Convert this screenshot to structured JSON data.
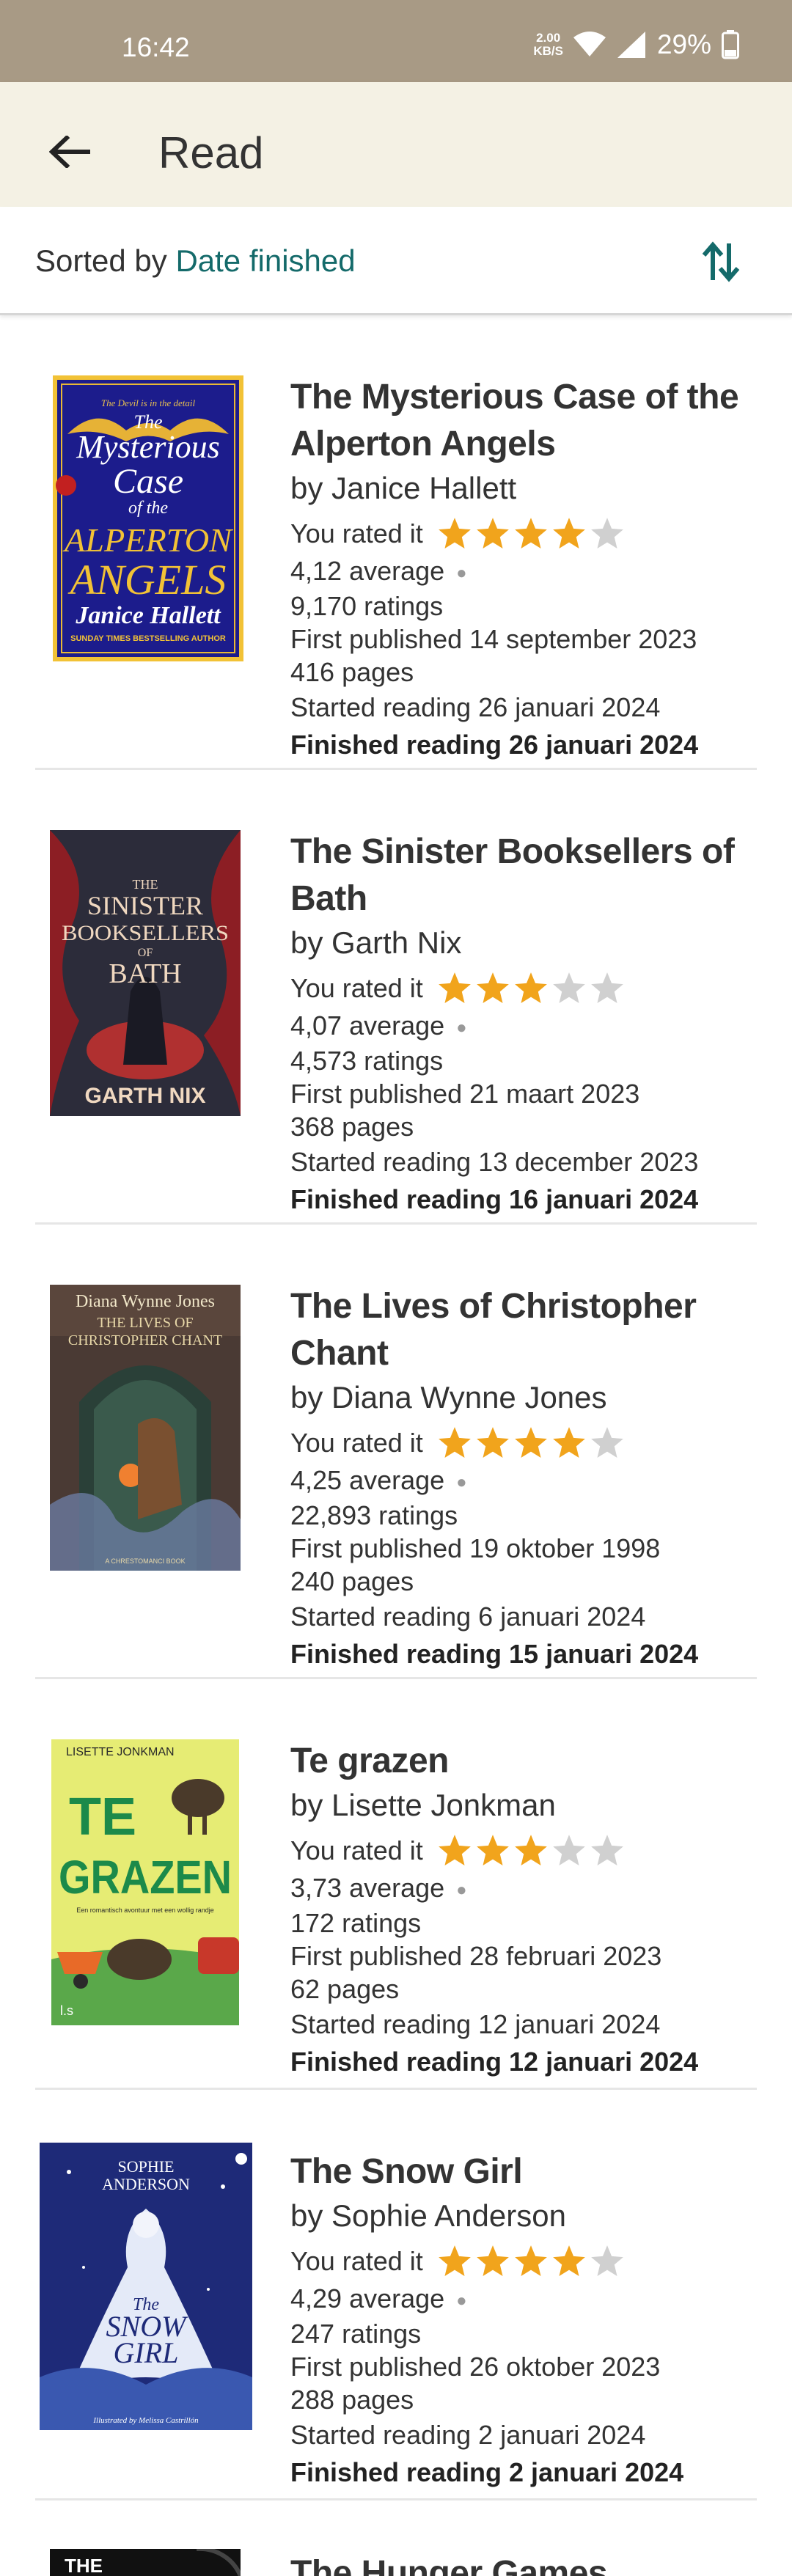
{
  "status": {
    "time": "16:42",
    "net_speed_value": "2.00",
    "net_speed_unit": "KB/S",
    "battery": "29%"
  },
  "appbar": {
    "title": "Read",
    "back_icon": "arrow-left-icon"
  },
  "sort": {
    "prefix": "Sorted by",
    "value": "Date finished",
    "icon": "sort-arrows-icon"
  },
  "colors": {
    "status_bar": "#a89a85",
    "app_bar": "#f4f1e4",
    "accent": "#146a6a",
    "star_filled": "#f1a41c",
    "star_empty": "#d0d0d0"
  },
  "labels": {
    "you_rated": "You rated it"
  },
  "books": [
    {
      "title": "The Mysterious Case of the Alperton Angels",
      "author": "by Janice Hallett",
      "rating": 4,
      "average": "4,12 average",
      "ratings": "9,170 ratings",
      "published": "First published 14 september 2023",
      "pages": "416 pages",
      "started": "Started reading 26 januari 2024",
      "finished": "Finished reading 26 januari 2024",
      "cover": {
        "top_line": "The Devil is in the detail",
        "line1": "The",
        "line2": "Mysterious",
        "line3": "Case",
        "line4": "of the",
        "line5": "ALPERTON",
        "line6": "ANGELS",
        "author": "Janice Hallett",
        "tagline": "SUNDAY TIMES BESTSELLING AUTHOR"
      }
    },
    {
      "title": "The Sinister Booksellers of Bath",
      "author": "by Garth Nix",
      "rating": 3,
      "average": "4,07 average",
      "ratings": "4,573 ratings",
      "published": "First published 21 maart 2023",
      "pages": "368 pages",
      "started": "Started reading 13 december 2023",
      "finished": "Finished reading 16 januari 2024",
      "cover": {
        "line1": "THE",
        "line2": "SINISTER",
        "line3": "BOOKSELLERS",
        "line4": "OF",
        "line5": "BATH",
        "author": "GARTH NIX"
      }
    },
    {
      "title": "The Lives of Christopher Chant",
      "author": "by Diana Wynne Jones",
      "rating": 4,
      "average": "4,25 average",
      "ratings": "22,893 ratings",
      "published": "First published 19 oktober 1998",
      "pages": "240 pages",
      "started": "Started reading 6 januari 2024",
      "finished": "Finished reading 15 januari 2024",
      "cover": {
        "author": "Diana Wynne Jones",
        "line1": "THE LIVES OF",
        "line2": "CHRISTOPHER CHANT",
        "footer": "A CHRESTOMANCI BOOK"
      }
    },
    {
      "title": "Te grazen",
      "author": "by Lisette Jonkman",
      "rating": 3,
      "average": "3,73 average",
      "ratings": "172 ratings",
      "published": "First published 28 februari 2023",
      "pages": "62 pages",
      "started": "Started reading 12 januari 2024",
      "finished": "Finished reading 12 januari 2024",
      "cover": {
        "author": "LISETTE JONKMAN",
        "line1": "TE",
        "line2": "GRAZEN",
        "tagline": "Een romantisch avontuur met een wollig randje",
        "badge": "l.s"
      }
    },
    {
      "title": "The Snow Girl",
      "author": "by Sophie Anderson",
      "rating": 4,
      "average": "4,29 average",
      "ratings": "247 ratings",
      "published": "First published 26 oktober 2023",
      "pages": "288 pages",
      "started": "Started reading 2 januari 2024",
      "finished": "Finished reading 2 januari 2024",
      "cover": {
        "author1": "SOPHIE",
        "author2": "ANDERSON",
        "line1": "The",
        "line2": "SNOW",
        "line3": "GIRL",
        "illustrator": "Illustrated by Melissa Castrillón"
      }
    },
    {
      "title": "The Hunger Games",
      "cover": {
        "line1": "THE"
      }
    }
  ]
}
